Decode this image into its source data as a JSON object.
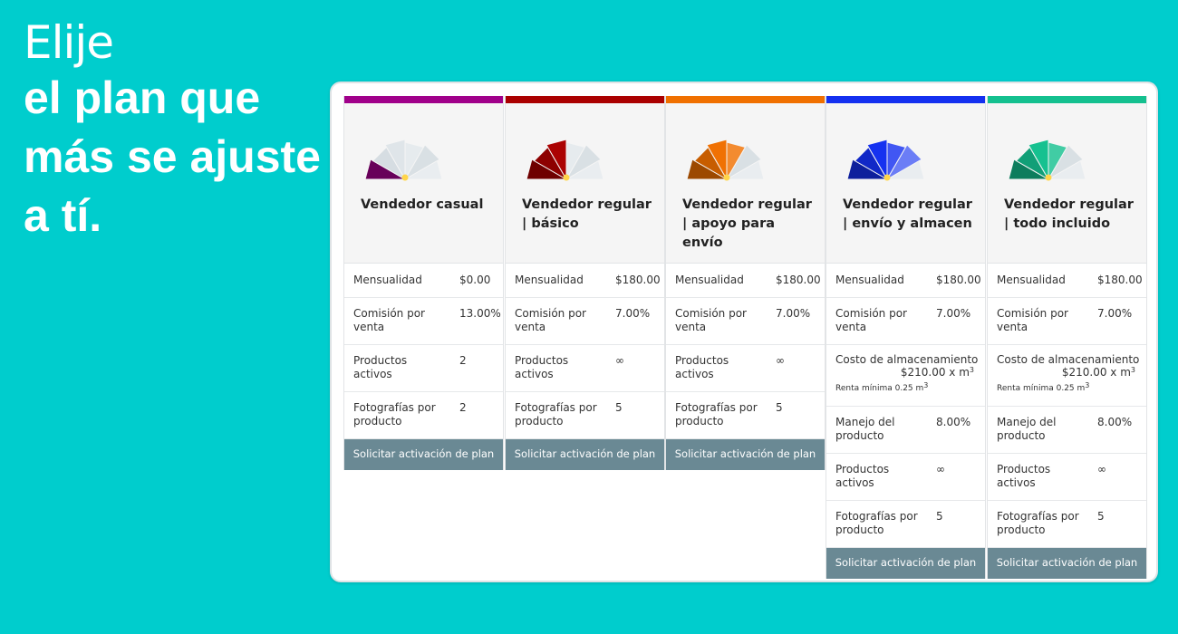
{
  "headline": {
    "line1": "Elije",
    "line2": "el plan que",
    "line3": "más se ajuste",
    "line4": "a tí."
  },
  "plans": [
    {
      "name": "Vendedor casual",
      "color": "#a0008a",
      "gauge_icon": "gauge-icon",
      "rows": {
        "monthly_label": "Mensualidad",
        "monthly_value": "$0.00",
        "commission_label": "Comisión por venta",
        "commission_value": "13.00%",
        "products_label": "Productos activos",
        "products_value": "2",
        "photos_label": "Fotografías por producto",
        "photos_value": "2"
      },
      "button": "Solicitar activación de plan"
    },
    {
      "name": "Vendedor regular | básico",
      "color": "#aa0000",
      "gauge_icon": "gauge-icon",
      "rows": {
        "monthly_label": "Mensualidad",
        "monthly_value": "$180.00",
        "commission_label": "Comisión por venta",
        "commission_value": "7.00%",
        "products_label": "Productos activos",
        "products_value": "∞",
        "photos_label": "Fotografías por producto",
        "photos_value": "5"
      },
      "button": "Solicitar activación de plan"
    },
    {
      "name": "Vendedor regular | apoyo para envío",
      "color": "#f07000",
      "gauge_icon": "gauge-icon",
      "rows": {
        "monthly_label": "Mensualidad",
        "monthly_value": "$180.00",
        "commission_label": "Comisión por venta",
        "commission_value": "7.00%",
        "products_label": "Productos activos",
        "products_value": "∞",
        "photos_label": "Fotografías por producto",
        "photos_value": "5"
      },
      "button": "Solicitar activación de plan"
    },
    {
      "name": "Vendedor regular | envío y almacen",
      "color": "#1430f0",
      "gauge_icon": "gauge-icon",
      "rows": {
        "monthly_label": "Mensualidad",
        "monthly_value": "$180.00",
        "commission_label": "Comisión por venta",
        "commission_value": "7.00%",
        "storage_label": "Costo de almacenamiento",
        "storage_value": "$210.00 x m",
        "storage_note": "Renta mínima 0.25 m",
        "handling_label": "Manejo del producto",
        "handling_value": "8.00%",
        "products_label": "Productos activos",
        "products_value": "∞",
        "photos_label": "Fotografías por producto",
        "photos_value": "5"
      },
      "button": "Solicitar activación de plan"
    },
    {
      "name": "Vendedor regular | todo incluido",
      "color": "#14c08f",
      "gauge_icon": "gauge-icon",
      "rows": {
        "monthly_label": "Mensualidad",
        "monthly_value": "$180.00",
        "commission_label": "Comisión por venta",
        "commission_value": "7.00%",
        "storage_label": "Costo de almacenamiento",
        "storage_value": "$210.00 x m",
        "storage_note": "Renta mínima 0.25 m",
        "handling_label": "Manejo del producto",
        "handling_value": "8.00%",
        "products_label": "Productos activos",
        "products_value": "∞",
        "photos_label": "Fotografías por producto",
        "photos_value": "5"
      },
      "button": "Solicitar activación de plan"
    }
  ],
  "superscript": "3"
}
